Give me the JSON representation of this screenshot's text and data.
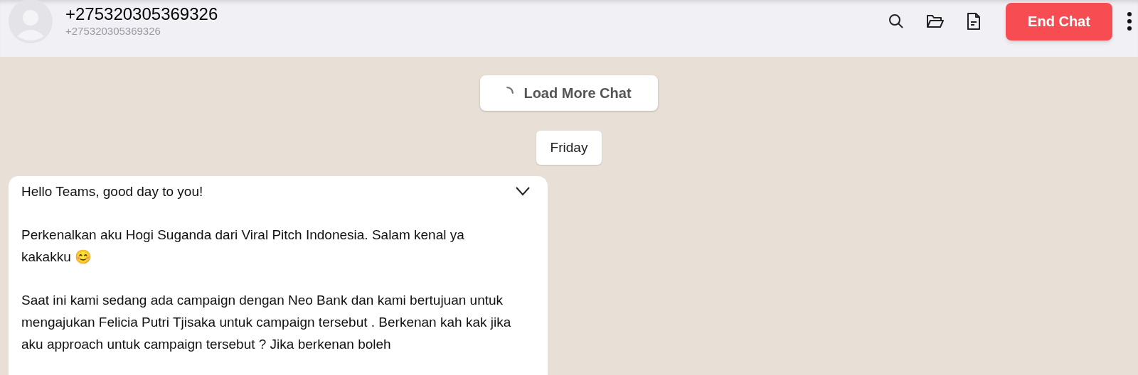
{
  "header": {
    "contact_name": "+275320305369326",
    "contact_number": "+275320305369326",
    "end_button": "End Chat"
  },
  "load_more": "Load More Chat",
  "date_divider": "Friday",
  "message": {
    "paragraphs": [
      "Hello Teams, good day to you!",
      "Perkenalkan aku Hogi Suganda dari Viral Pitch Indonesia. Salam kenal ya kakakku 😊",
      "Saat ini kami sedang ada campaign dengan Neo Bank dan kami bertujuan untuk mengajukan Felicia Putri Tjisaka untuk campaign tersebut . Berkenan kah kak jika aku approach untuk campaign tersebut ? Jika berkenan boleh"
    ]
  }
}
